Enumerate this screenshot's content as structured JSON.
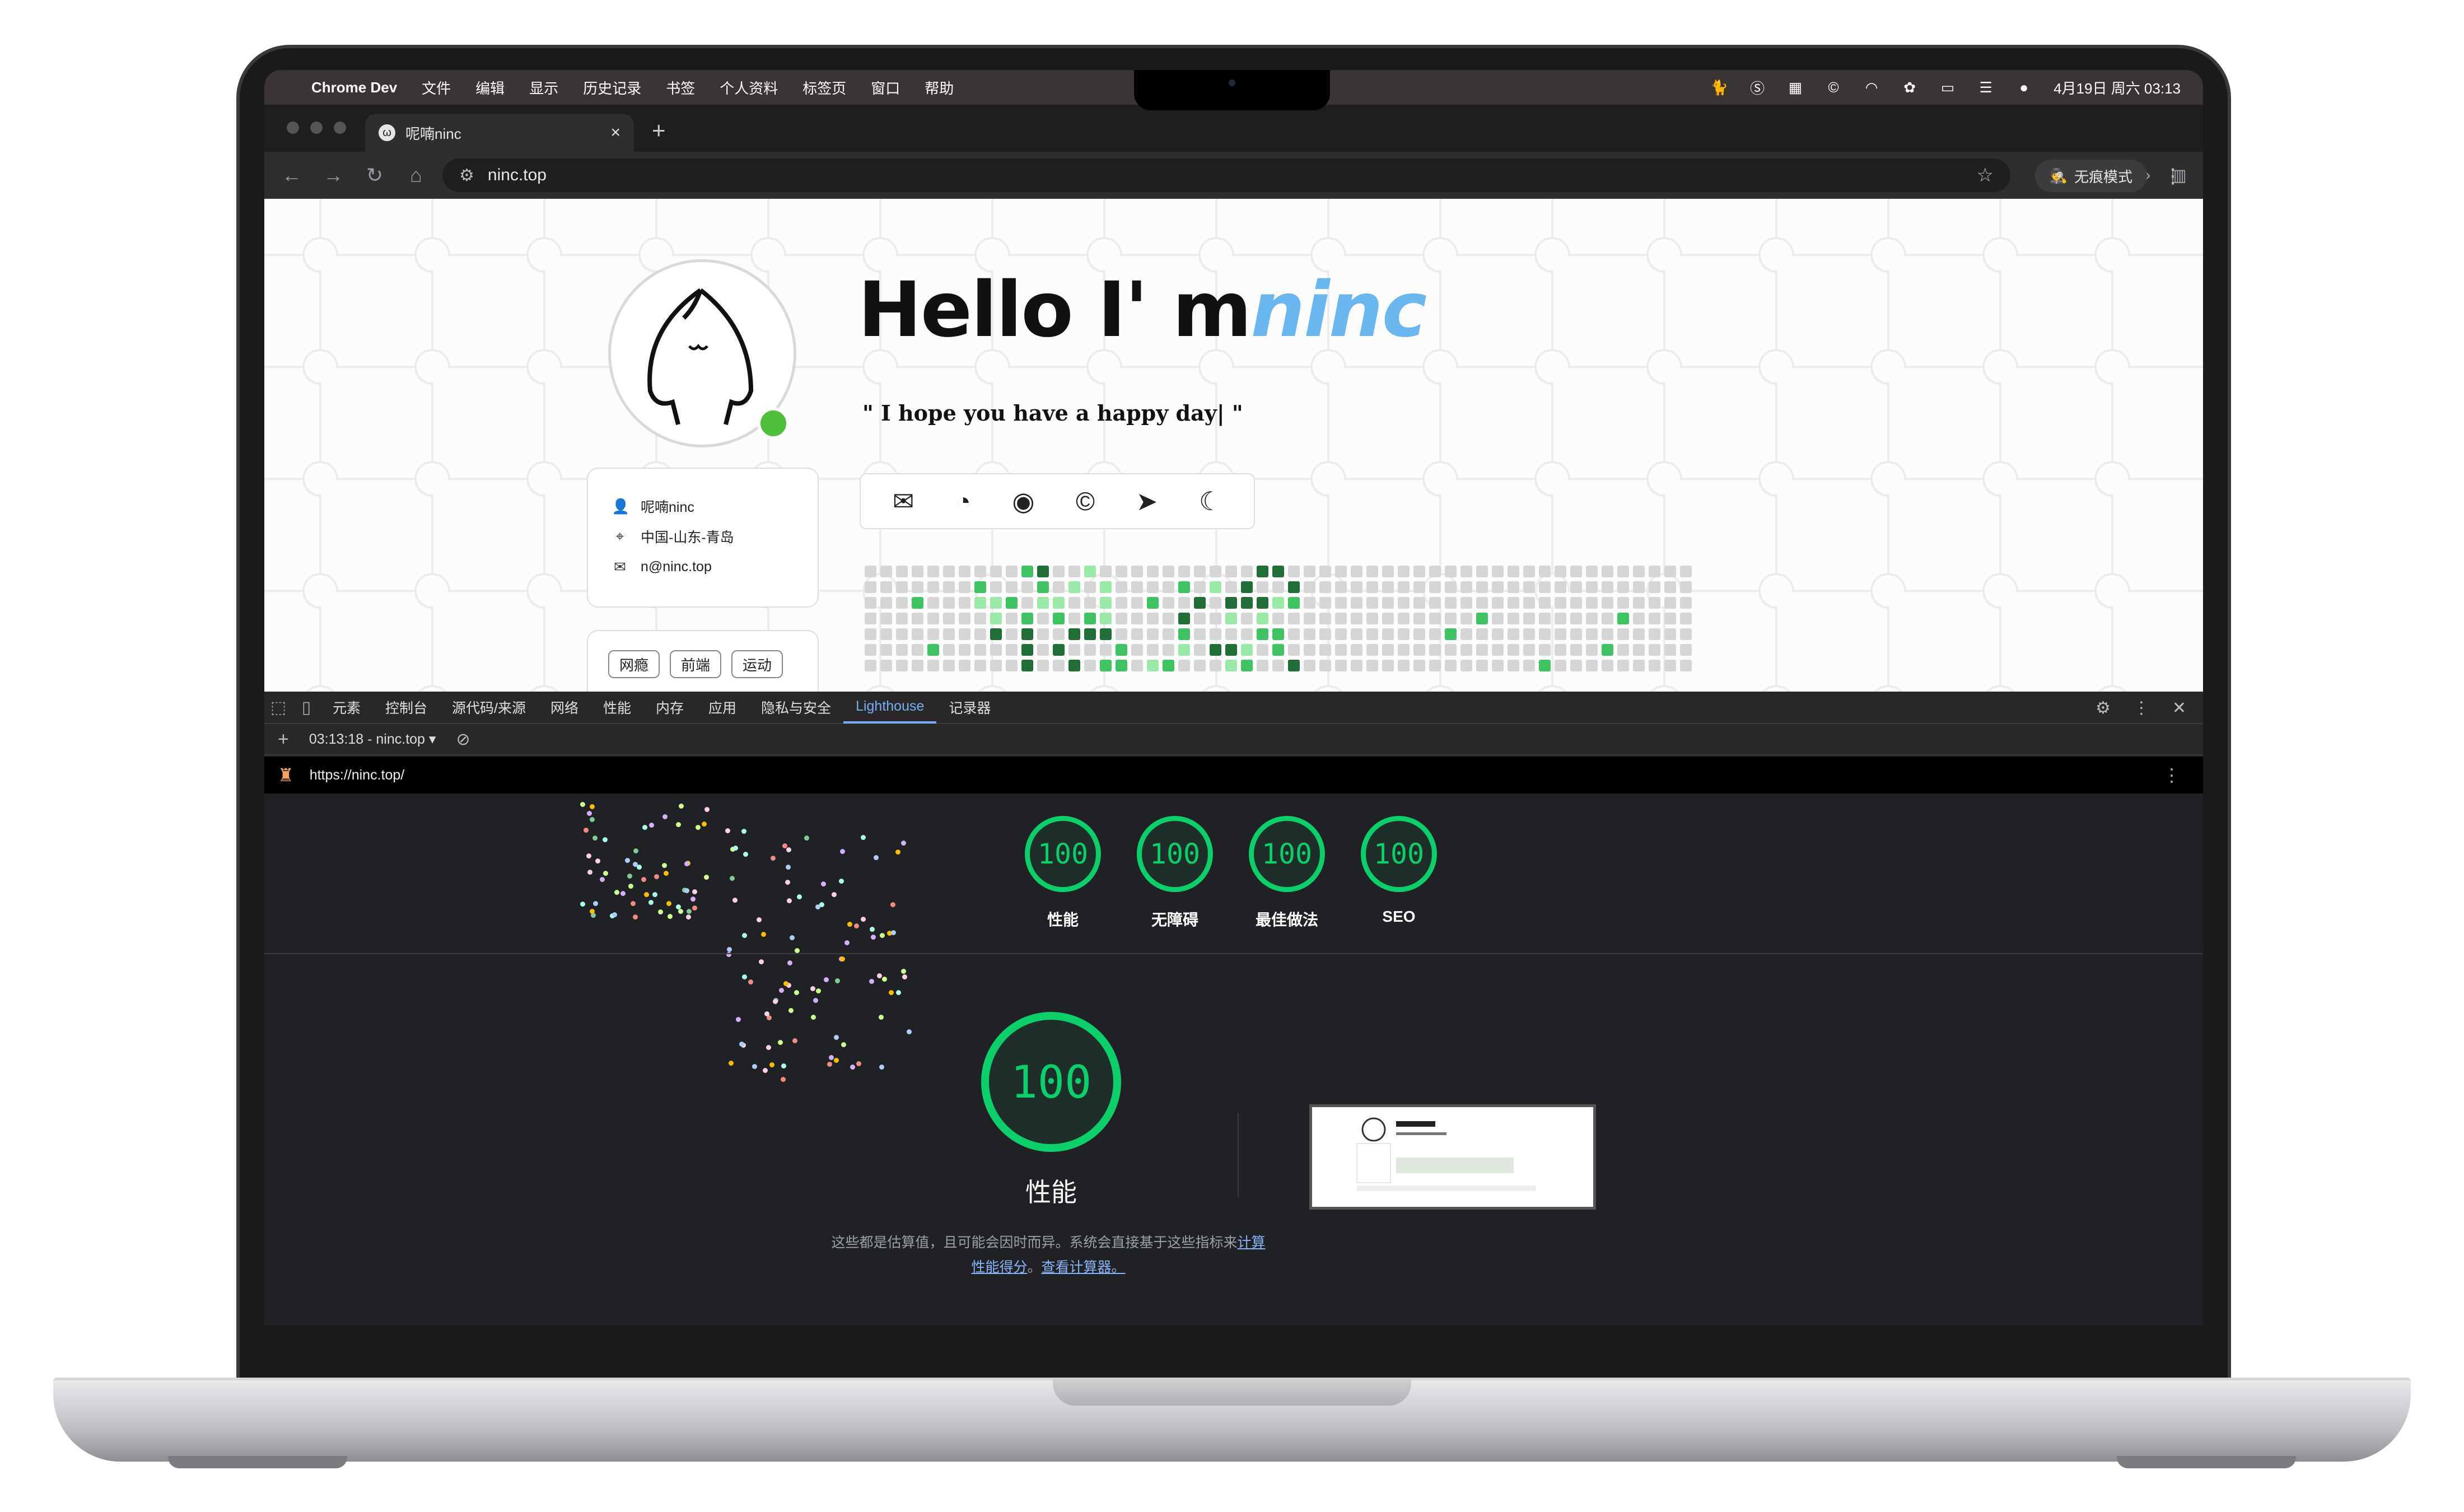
{
  "menubar": {
    "app_name": "Chrome Dev",
    "items": [
      "文件",
      "编辑",
      "显示",
      "历史记录",
      "书签",
      "个人资料",
      "标签页",
      "窗口",
      "帮助"
    ],
    "clock": "4月19日 周六  03:13"
  },
  "browser": {
    "tab_title": "呢喃ninc",
    "url": "ninc.top",
    "incognito_label": "无痕模式"
  },
  "page": {
    "headline_main": "Hello I' m",
    "headline_accent": "ninc",
    "quote": "\" I hope you have a happy day| \"",
    "profile": {
      "name": "呢喃ninc",
      "location": "中国-山东-青岛",
      "email": "n@ninc.top"
    },
    "tags": [
      "网瘾",
      "前端",
      "运动"
    ],
    "social_icons": [
      "mail-icon",
      "rss-icon",
      "github-icon",
      "copyright-icon",
      "telegram-icon",
      "moon-icon"
    ]
  },
  "devtools": {
    "tabs": [
      "元素",
      "控制台",
      "源代码/来源",
      "网络",
      "性能",
      "内存",
      "应用",
      "隐私与安全",
      "Lighthouse",
      "记录器"
    ],
    "active_tab": "Lighthouse",
    "report_select": "03:13:18 - ninc.top",
    "report_url": "https://ninc.top/",
    "scores": [
      {
        "label": "性能",
        "value": "100"
      },
      {
        "label": "无障碍",
        "value": "100"
      },
      {
        "label": "最佳做法",
        "value": "100"
      },
      {
        "label": "SEO",
        "value": "100"
      }
    ],
    "main_score": {
      "label": "性能",
      "value": "100"
    },
    "note_text": "这些都是估算值，且可能会因时而异。系统会直接基于这些指标来",
    "note_link1": "计算性能得分",
    "note_sep": "。",
    "note_link2": "查看计算器。",
    "colors": {
      "pass": "#0cce6b",
      "link": "#8ab4f8",
      "accent_tab": "#7cacf8"
    }
  }
}
